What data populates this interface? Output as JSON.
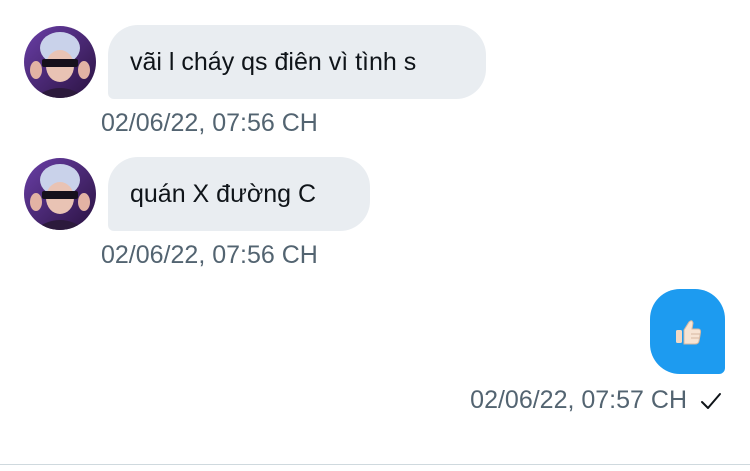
{
  "conversation": {
    "messages": [
      {
        "direction": "incoming",
        "text": "vãi l cháy qs điên vì tình s",
        "timestamp": "02/06/22, 07:56 CH"
      },
      {
        "direction": "incoming",
        "text": "quán X đường C",
        "timestamp": "02/06/22, 07:56 CH"
      },
      {
        "direction": "outgoing",
        "content_icon": "thumbs-up-emoji",
        "timestamp": "02/06/22, 07:57 CH",
        "status_icon": "check-icon"
      }
    ]
  },
  "colors": {
    "incoming_bubble": "#e9edf1",
    "outgoing_bubble": "#1d9bf0",
    "timestamp_text": "#536471",
    "message_text": "#0f1419"
  }
}
